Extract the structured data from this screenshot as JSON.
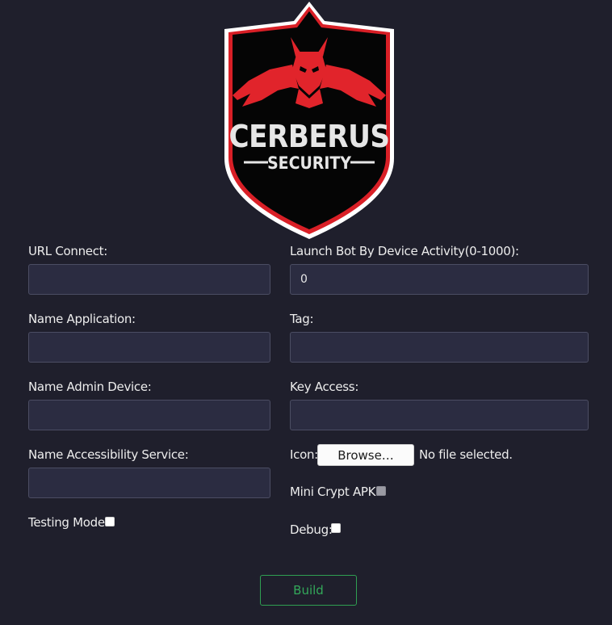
{
  "logo": {
    "title": "CERBERUS",
    "subtitle": "SECURITY",
    "colors": {
      "shield": "#000000",
      "outline": "#d91f26",
      "border": "#ffffff",
      "text": "#e6e6e6"
    }
  },
  "form": {
    "url_connect": {
      "label": "URL Connect:",
      "value": ""
    },
    "launch_bot": {
      "label": "Launch Bot By Device Activity(0-1000):",
      "value": "0"
    },
    "name_application": {
      "label": "Name Application:",
      "value": ""
    },
    "tag": {
      "label": "Tag:",
      "value": ""
    },
    "name_admin_device": {
      "label": "Name Admin Device:",
      "value": ""
    },
    "key_access": {
      "label": "Key Access:",
      "value": ""
    },
    "name_accessibility_service": {
      "label": "Name Accessibility Service:",
      "value": ""
    },
    "icon": {
      "label": "Icon:",
      "browse_label": "Browse…",
      "status": "No file selected."
    },
    "mini_crypt_apk": {
      "label": "Mini Crypt APK:",
      "checked": false,
      "disabled": true
    },
    "testing_mode": {
      "label": "Testing Mode:",
      "checked": false
    },
    "debug": {
      "label": "Debug:",
      "checked": false
    }
  },
  "build_button": {
    "label": "Build",
    "color": "#33a85a"
  }
}
